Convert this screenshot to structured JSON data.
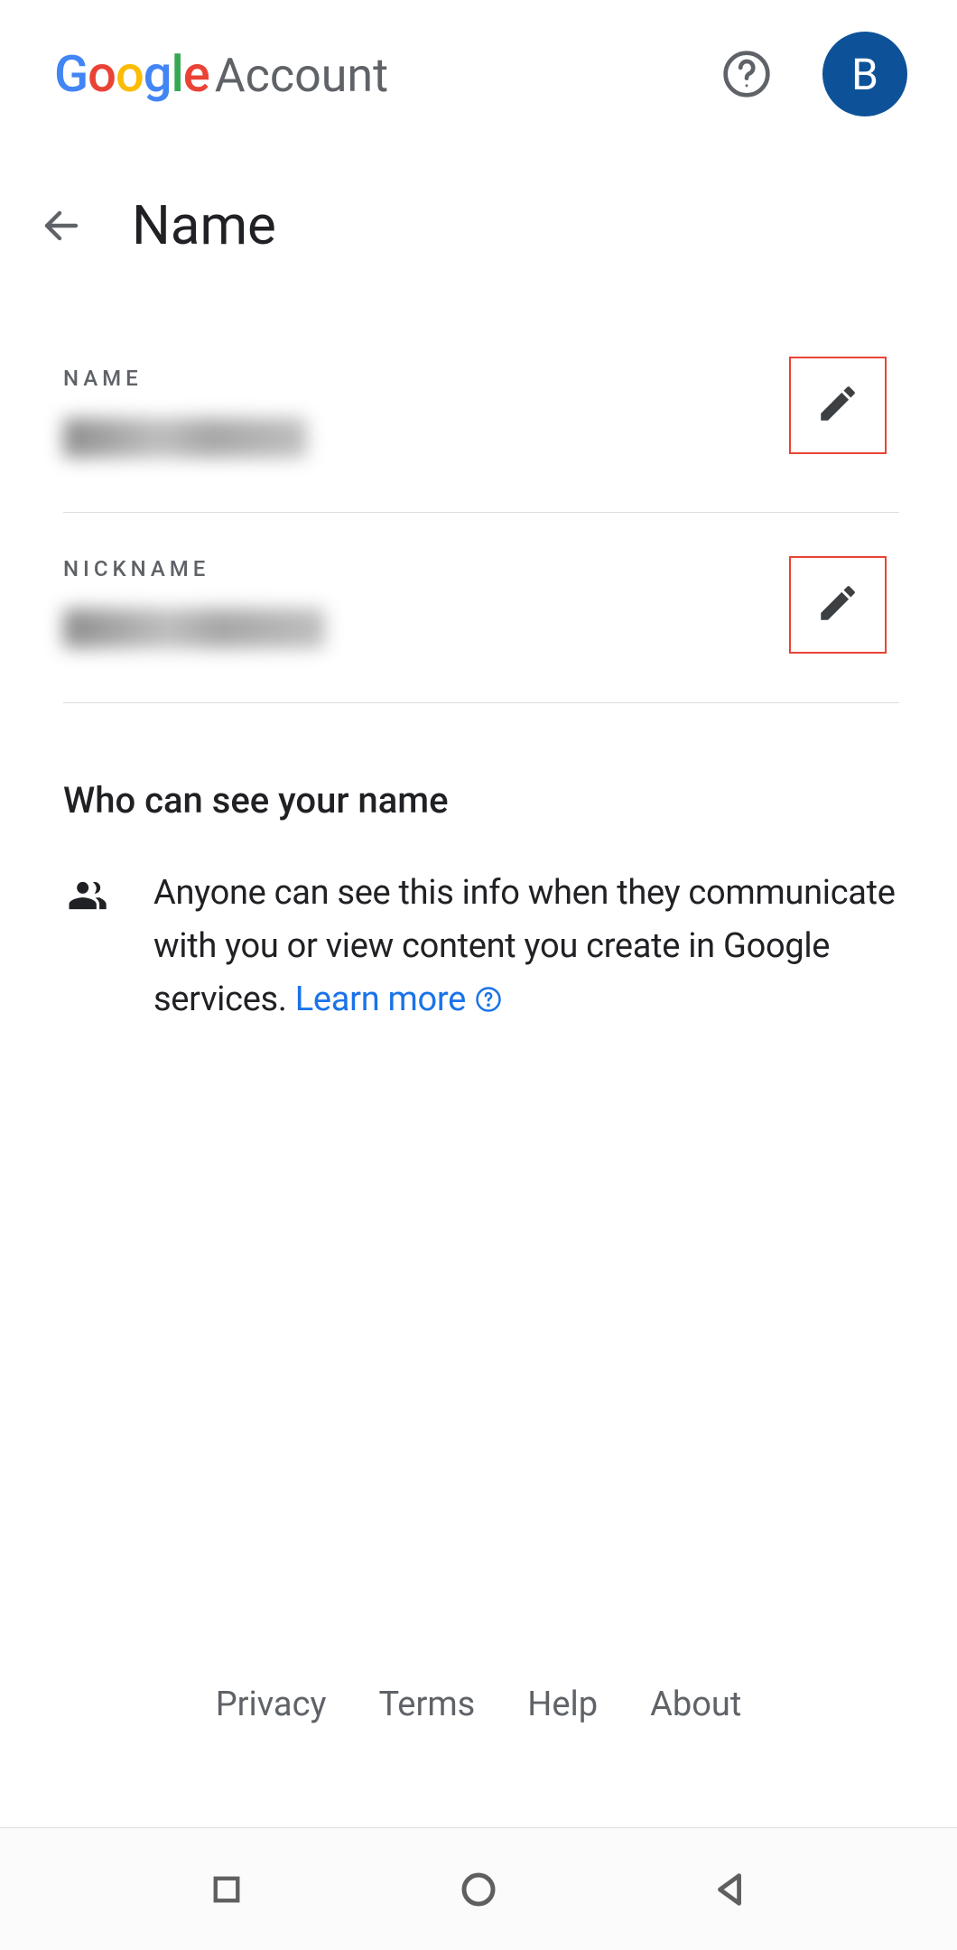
{
  "header": {
    "logo_google": "Google",
    "logo_account": "Account",
    "avatar_letter": "B"
  },
  "page": {
    "title": "Name"
  },
  "fields": {
    "name_label": "NAME",
    "nickname_label": "NICKNAME"
  },
  "visibility": {
    "heading": "Who can see your name",
    "description": "Anyone can see this info when they communicate with you or view content you create in Google services. ",
    "learn_more": "Learn more"
  },
  "footer": {
    "privacy": "Privacy",
    "terms": "Terms",
    "help": "Help",
    "about": "About"
  }
}
